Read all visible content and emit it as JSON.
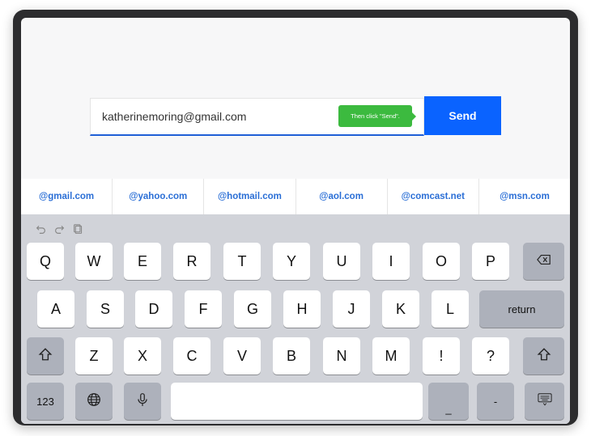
{
  "email_form": {
    "input_value": "katherinemoring@gmail.com",
    "tooltip": "Then click \"Send\".",
    "send_label": "Send",
    "accent_color": "#0a63ff"
  },
  "suggestions": [
    "@gmail.com",
    "@yahoo.com",
    "@hotmail.com",
    "@aol.com",
    "@comcast.net",
    "@msn.com"
  ],
  "keyboard": {
    "row1": [
      "Q",
      "W",
      "E",
      "R",
      "T",
      "Y",
      "U",
      "I",
      "O",
      "P"
    ],
    "row2": [
      "A",
      "S",
      "D",
      "F",
      "G",
      "H",
      "J",
      "K",
      "L"
    ],
    "row3": [
      "Z",
      "X",
      "C",
      "V",
      "B",
      "N",
      "M",
      "!",
      "?"
    ],
    "return_label": "return",
    "numbers_label": "123",
    "underscore_label": "_",
    "dash_label": "-",
    "icons": [
      "undo-icon",
      "redo-icon",
      "paste-icon",
      "backspace-icon",
      "shift-icon",
      "globe-icon",
      "microphone-icon",
      "keyboard-hide-icon"
    ]
  }
}
